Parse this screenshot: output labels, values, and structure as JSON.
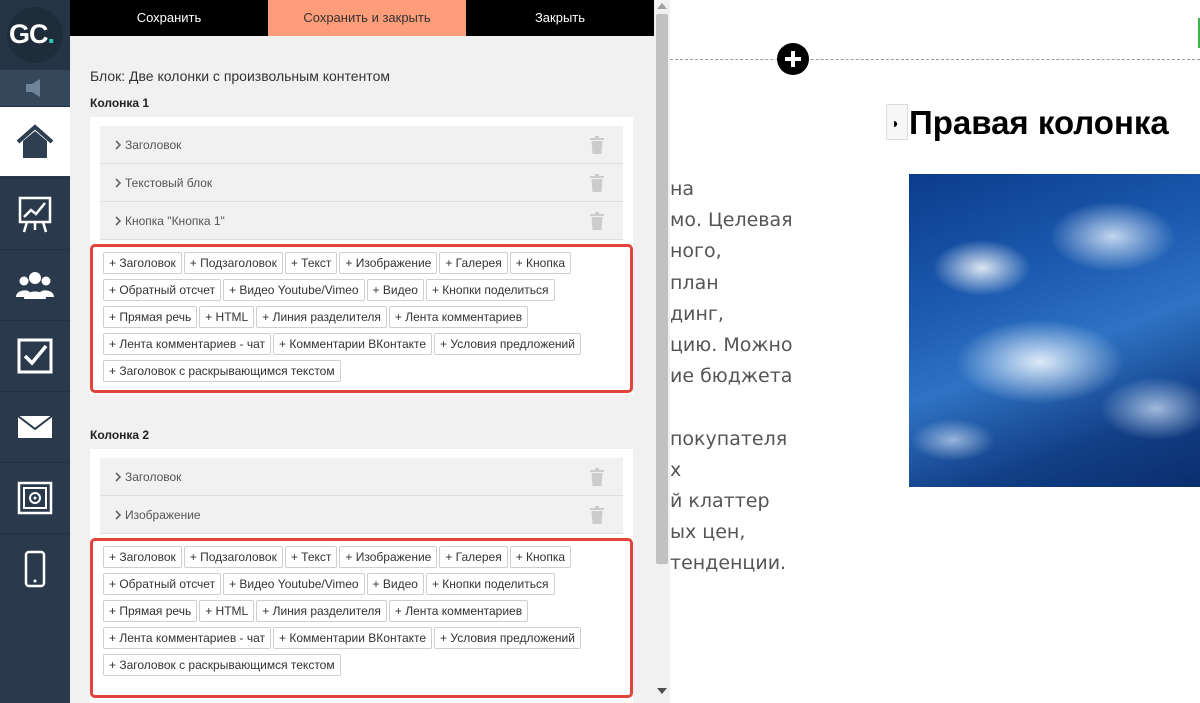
{
  "sidebar": {
    "logo": {
      "text": "GC",
      "dot": "."
    },
    "items": [
      {
        "icon": "home-icon"
      },
      {
        "icon": "chart-board-icon"
      },
      {
        "icon": "users-icon"
      },
      {
        "icon": "checkbox-icon"
      },
      {
        "icon": "mail-icon"
      },
      {
        "icon": "safe-icon"
      },
      {
        "icon": "mobile-icon"
      }
    ]
  },
  "toolbar": {
    "save_label": "Сохранить",
    "save_close_label": "Сохранить и закрыть",
    "close_label": "Закрыть"
  },
  "panel": {
    "block_title": "Блок: Две колонки с произвольным контентом",
    "columns": [
      {
        "title": "Колонка 1",
        "items": [
          "Заголовок",
          "Текстовый блок",
          "Кнопка \"Кнопка 1\""
        ]
      },
      {
        "title": "Колонка 2",
        "items": [
          "Заголовок",
          "Изображение"
        ]
      }
    ],
    "add_buttons": [
      "+ Заголовок",
      "+ Подзаголовок",
      "+ Текст",
      "+ Изображение",
      "+ Галерея",
      "+ Кнопка",
      "+ Обратный отсчет",
      "+ Видео Youtube/Vimeo",
      "+ Видео",
      "+ Кнопки поделиться",
      "+ Прямая речь",
      "+ HTML",
      "+ Линия разделителя",
      "+ Лента комментариев",
      "+ Лента комментариев - чат",
      "+ Комментарии ВКонтакте",
      "+ Условия предложений",
      "+ Заголовок с раскрывающимся текстом"
    ]
  },
  "preview": {
    "heading": "Правая колонка",
    "contrast_symbol": "◑",
    "text_lines": [
      "на",
      "мо. Целевая",
      "ного,",
      "план",
      "динг,",
      "цию. Можно",
      "ие бюджета",
      "",
      "покупателя",
      "х",
      "й клаттер",
      "ых цен,",
      "тенденции."
    ]
  },
  "colors": {
    "sidebar_bg": "#2a3a4c",
    "accent_teal": "#2fc7b5",
    "save_close_bg": "#ff9d7a",
    "highlight_red": "#e2433a",
    "green_marker": "#3cb44a"
  }
}
